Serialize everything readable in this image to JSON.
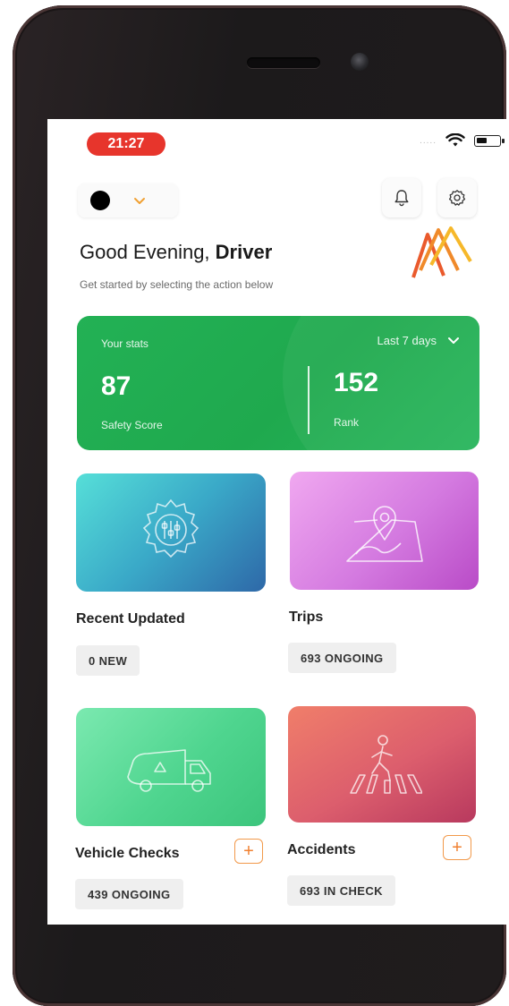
{
  "status_bar": {
    "time": "21:27",
    "signal": "....."
  },
  "header": {
    "greeting_prefix": "Good Evening, ",
    "greeting_name": "Driver",
    "subtitle": "Get started by selecting the action below"
  },
  "stats": {
    "title": "Your stats",
    "period": "Last 7 days",
    "safety_score": {
      "value": "87",
      "label": "Safety Score"
    },
    "rank": {
      "value": "152",
      "label": "Rank"
    }
  },
  "cards": [
    {
      "title": "Recent Updated",
      "badge": "0 NEW",
      "icon": "gear-sliders-icon"
    },
    {
      "title": "Trips",
      "badge": "693 ONGOING",
      "icon": "map-pin-icon"
    },
    {
      "title": "Vehicle Checks",
      "badge": "439 ONGOING",
      "icon": "truck-icon",
      "add": "+"
    },
    {
      "title": "Accidents",
      "badge": "693 IN CHECK",
      "icon": "pedestrian-crossing-icon",
      "add": "+"
    }
  ],
  "colors": {
    "accent_red": "#e7352c",
    "stats_green": "#23b155",
    "plus_orange": "#f08030"
  }
}
